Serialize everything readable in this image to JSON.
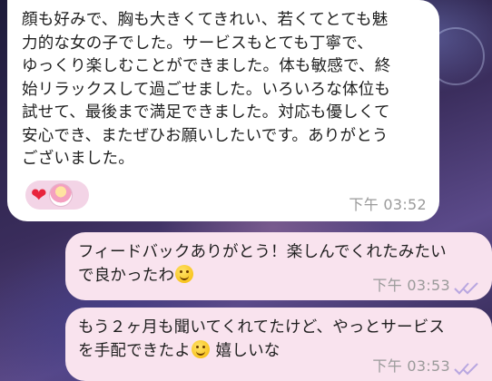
{
  "incoming": {
    "text": "顔も好みで、胸も大きくてきれい、若くてとても魅\n力的な女の子でした。サービスもとても丁寧で、\nゆっくり楽しむことができました。体も敏感で、終\n始リラックスして過ごせました。いろいろな体位も\n試せて、最後まで満足できました。対応も優しくて\n安心でき、またぜひお願いしたいです。ありがとう\nございました。",
    "time": "下午 03:52",
    "reactions": [
      "heart-emoji",
      "avatar-sticker"
    ]
  },
  "outgoing": [
    {
      "text_before": "フィードバックありがとう！楽しんでくれたみたい\nで良かったわ",
      "emoji": "smiling-face-emoji",
      "text_after": "",
      "time": "下午 03:53",
      "status_icon": "double-check-icon"
    },
    {
      "text_before": "もう２ヶ月も聞いてくれてたけど、やっとサービス\nを手配できたよ",
      "emoji": "smiling-face-emoji",
      "text_after": " 嬉しいな",
      "time": "下午 03:53",
      "status_icon": "double-check-icon"
    }
  ],
  "colors": {
    "incoming_bubble": "#ffffff",
    "outgoing_bubble": "#f9e3ee",
    "check_color": "#b8a6e0",
    "reaction_pill": "#f3d4e6"
  }
}
